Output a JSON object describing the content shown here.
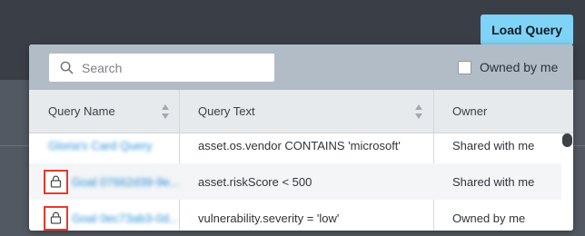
{
  "toolbar": {
    "load_query_label": "Load Query"
  },
  "search": {
    "placeholder": "Search",
    "value": ""
  },
  "filter": {
    "owned_by_me_label": "Owned by me",
    "owned_by_me_checked": false
  },
  "table": {
    "columns": [
      {
        "label": "Query Name",
        "sortable": true
      },
      {
        "label": "Query Text",
        "sortable": true
      },
      {
        "label": "Owner",
        "sortable": false
      }
    ],
    "rows": [
      {
        "name": "Gloria's Card Query",
        "text": "asset.os.vendor CONTAINS 'microsoft'",
        "owner": "Shared with me",
        "locked": false
      },
      {
        "name": "Goal 07662d39-9e...",
        "text": "asset.riskScore < 500",
        "owner": "Shared with me",
        "locked": true
      },
      {
        "name": "Goal 0ec73ab3-0d...",
        "text": "vulnerability.severity = 'low'",
        "owner": "Owned by me",
        "locked": true
      }
    ]
  },
  "colors": {
    "accent": "#7fd3f7",
    "link": "#2a8fd6",
    "highlight": "#e53b2c",
    "header_bg": "#b2bcc6"
  },
  "icons": {
    "search": "search-icon",
    "lock": "lock-icon",
    "sort": "sort-icon"
  }
}
